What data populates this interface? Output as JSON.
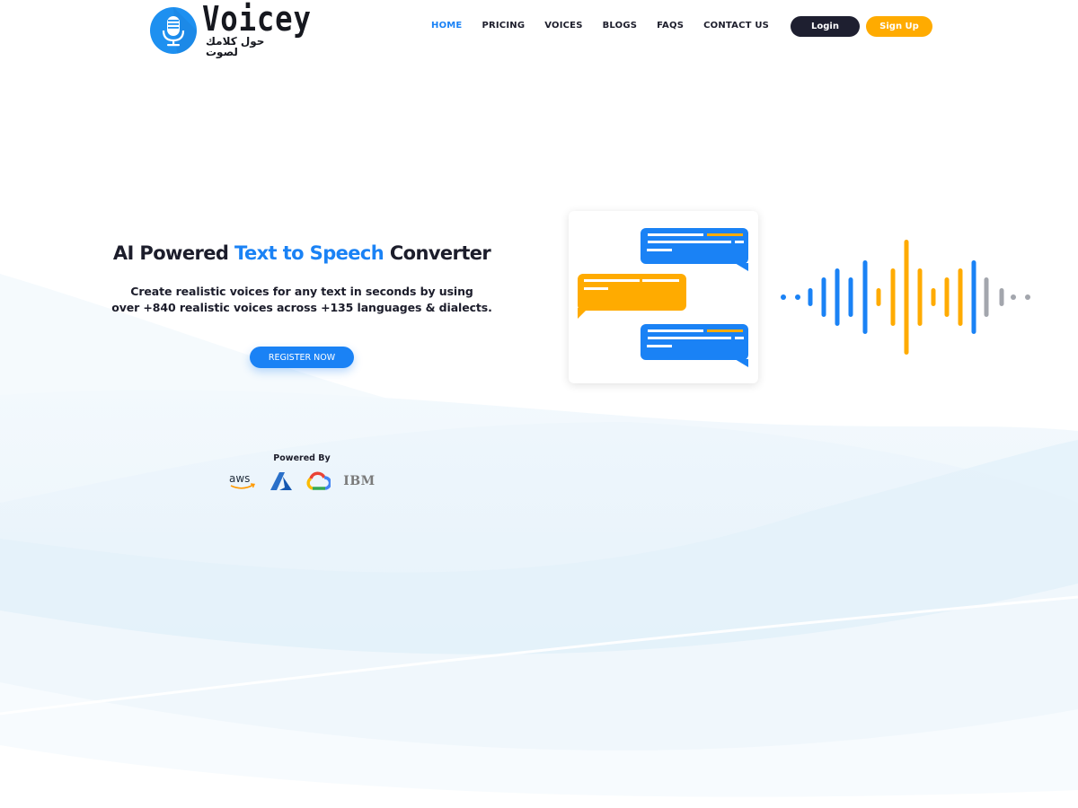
{
  "brand": {
    "name": "Voicey",
    "tagline_arabic": "حول كلامك لصوت",
    "logo_icon": "microphone-icon"
  },
  "nav": {
    "items": [
      {
        "label": "HOME",
        "active": true
      },
      {
        "label": "PRICING",
        "active": false
      },
      {
        "label": "VOICES",
        "active": false
      },
      {
        "label": "BLOGS",
        "active": false
      },
      {
        "label": "FAQS",
        "active": false
      },
      {
        "label": "CONTACT US",
        "active": false
      }
    ],
    "login_label": "Login",
    "signup_label": "Sign Up"
  },
  "hero": {
    "title_part1": "AI Powered ",
    "title_highlight": "Text to Speech",
    "title_part2": " Converter",
    "subtitle_line1": "Create realistic voices for any text in seconds by using",
    "subtitle_line2": "over +840 realistic voices across +135 languages & dialects.",
    "cta_label": "REGISTER NOW"
  },
  "powered_by": {
    "label": "Powered By",
    "providers": [
      {
        "name": "aws",
        "icon": "aws-logo-icon"
      },
      {
        "name": "Azure",
        "icon": "azure-logo-icon"
      },
      {
        "name": "Google Cloud",
        "icon": "google-cloud-logo-icon"
      },
      {
        "name": "IBM",
        "icon": "ibm-logo-icon"
      }
    ]
  },
  "illustration": {
    "chat_icon": "chat-bubbles-illustration",
    "wave_icon": "sound-wave-illustration"
  },
  "colors": {
    "accent_blue": "#1a82f5",
    "accent_orange": "#ffab00",
    "dark": "#1e1f30",
    "gray": "#a3a6ad"
  }
}
